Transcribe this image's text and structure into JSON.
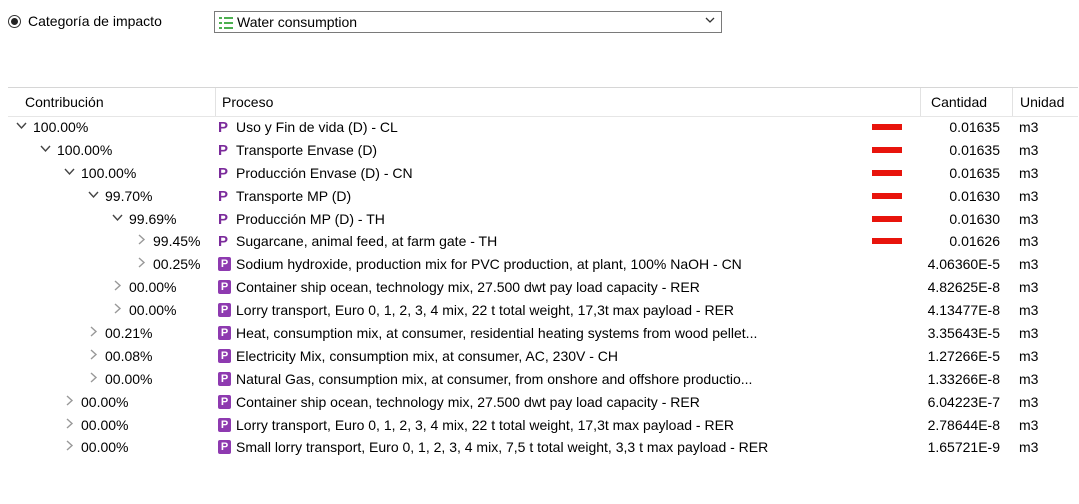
{
  "impact_selector": {
    "label": "Categoría de impacto",
    "selected": "Water consumption"
  },
  "columns": {
    "contribution": "Contribución",
    "process": "Proceso",
    "amount": "Cantidad",
    "unit": "Unidad"
  },
  "rows": [
    {
      "depth": 0,
      "expanded": true,
      "percent": "100.00%",
      "icon": "process-icon",
      "process": "Uso y Fin de vida (D) - CL",
      "bar": true,
      "amount": "0.01635",
      "unit": "m3"
    },
    {
      "depth": 1,
      "expanded": true,
      "percent": "100.00%",
      "icon": "process-icon",
      "process": "Transporte Envase (D)",
      "bar": true,
      "amount": "0.01635",
      "unit": "m3"
    },
    {
      "depth": 2,
      "expanded": true,
      "percent": "100.00%",
      "icon": "process-icon",
      "process": "Producción Envase (D) - CN",
      "bar": true,
      "amount": "0.01635",
      "unit": "m3"
    },
    {
      "depth": 3,
      "expanded": true,
      "percent": "99.70%",
      "icon": "process-icon",
      "process": "Transporte MP (D)",
      "bar": true,
      "amount": "0.01630",
      "unit": "m3"
    },
    {
      "depth": 4,
      "expanded": true,
      "percent": "99.69%",
      "icon": "process-icon",
      "process": "Producción MP (D) - TH",
      "bar": true,
      "amount": "0.01630",
      "unit": "m3"
    },
    {
      "depth": 5,
      "expanded": false,
      "percent": "99.45%",
      "icon": "process-icon",
      "process": "Sugarcane, animal feed, at farm gate - TH",
      "bar": true,
      "amount": "0.01626",
      "unit": "m3"
    },
    {
      "depth": 5,
      "expanded": false,
      "percent": "00.25%",
      "icon": "system-process-icon",
      "process": "Sodium hydroxide, production mix for PVC production, at plant, 100% NaOH - CN",
      "bar": false,
      "amount": "4.06360E-5",
      "unit": "m3"
    },
    {
      "depth": 4,
      "expanded": false,
      "percent": "00.00%",
      "icon": "system-process-icon",
      "process": "Container ship ocean, technology mix, 27.500 dwt pay load capacity - RER",
      "bar": false,
      "amount": "4.82625E-8",
      "unit": "m3"
    },
    {
      "depth": 4,
      "expanded": false,
      "percent": "00.00%",
      "icon": "system-process-icon",
      "process": "Lorry transport, Euro 0, 1, 2, 3, 4 mix, 22 t total weight, 17,3t max payload - RER",
      "bar": false,
      "amount": "4.13477E-8",
      "unit": "m3"
    },
    {
      "depth": 3,
      "expanded": false,
      "percent": "00.21%",
      "icon": "system-process-icon",
      "process": "Heat, consumption mix, at consumer, residential heating systems from wood pellet...",
      "bar": false,
      "amount": "3.35643E-5",
      "unit": "m3"
    },
    {
      "depth": 3,
      "expanded": false,
      "percent": "00.08%",
      "icon": "system-process-icon",
      "process": "Electricity Mix, consumption mix, at consumer, AC, 230V - CH",
      "bar": false,
      "amount": "1.27266E-5",
      "unit": "m3"
    },
    {
      "depth": 3,
      "expanded": false,
      "percent": "00.00%",
      "icon": "system-process-icon",
      "process": "Natural Gas, consumption mix, at consumer, from onshore and offshore productio...",
      "bar": false,
      "amount": "1.33266E-8",
      "unit": "m3"
    },
    {
      "depth": 2,
      "expanded": false,
      "percent": "00.00%",
      "icon": "system-process-icon",
      "process": "Container ship ocean, technology mix, 27.500 dwt pay load capacity - RER",
      "bar": false,
      "amount": "6.04223E-7",
      "unit": "m3"
    },
    {
      "depth": 2,
      "expanded": false,
      "percent": "00.00%",
      "icon": "system-process-icon",
      "process": "Lorry transport, Euro 0, 1, 2, 3, 4 mix, 22 t total weight, 17,3t max payload - RER",
      "bar": false,
      "amount": "2.78644E-8",
      "unit": "m3"
    },
    {
      "depth": 2,
      "expanded": false,
      "percent": "00.00%",
      "icon": "system-process-icon",
      "process": "Small lorry transport, Euro 0, 1, 2, 3, 4 mix, 7,5 t total weight, 3,3 t max payload - RER",
      "bar": false,
      "amount": "1.65721E-9",
      "unit": "m3"
    }
  ],
  "colors": {
    "bar": "#e8140c",
    "process_icon": "#7b2b9b"
  }
}
